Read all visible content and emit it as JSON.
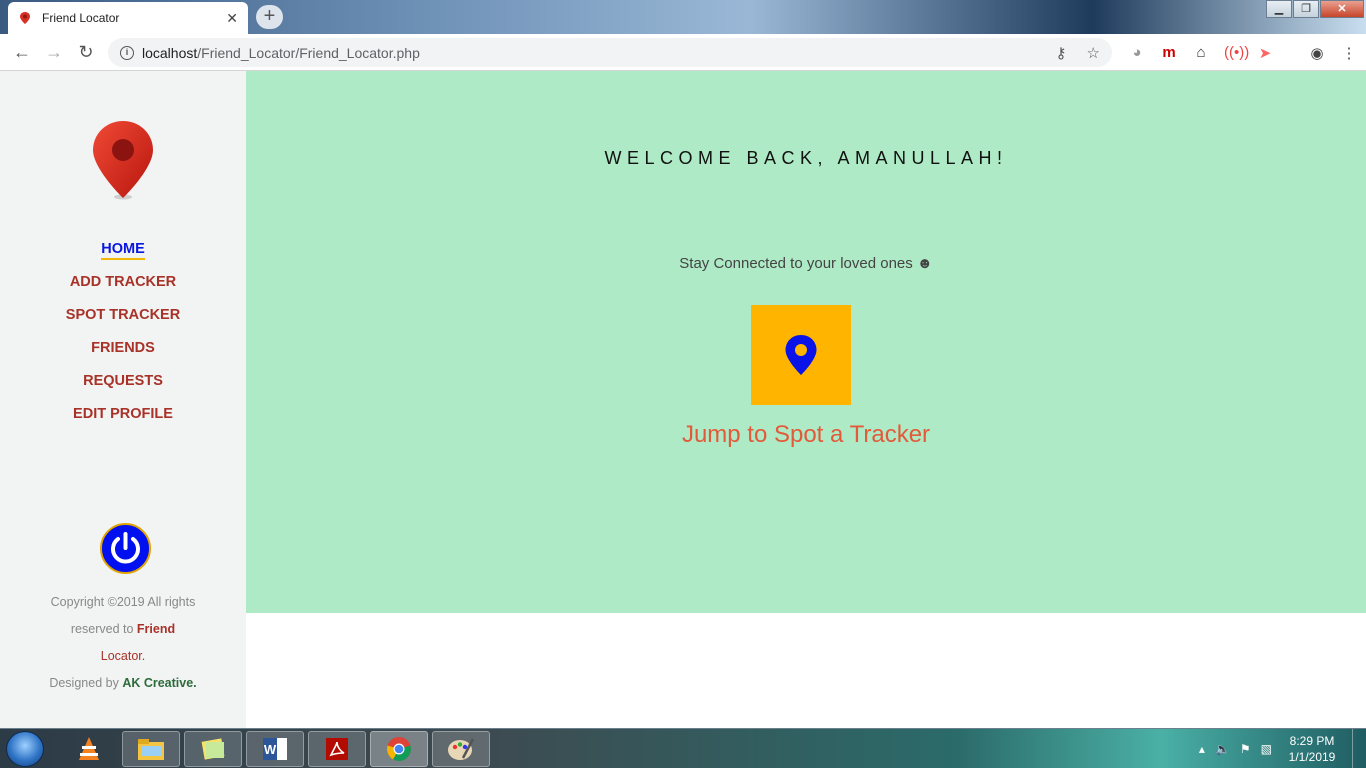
{
  "browser": {
    "tab_title": "Friend Locator",
    "tab_close": "✕",
    "new_tab": "+",
    "url_host": "localhost",
    "url_path": "/Friend_Locator/Friend_Locator.php",
    "window_buttons": [
      "▁",
      "❐",
      "✕"
    ]
  },
  "sidebar": {
    "nav": [
      {
        "label": "HOME",
        "active": true
      },
      {
        "label": "ADD TRACKER"
      },
      {
        "label": "SPOT TRACKER"
      },
      {
        "label": "FRIENDS"
      },
      {
        "label": "REQUESTS"
      },
      {
        "label": "EDIT PROFILE"
      }
    ],
    "copyright_prefix": "Copyright ©2019 All rights reserved to",
    "copyright_brand": "Friend",
    "copyright_brand2": "Locator.",
    "designed_prefix": "Designed by",
    "designer": "AK Creative."
  },
  "main": {
    "welcome": "WELCOME BACK, AMANULLAH!",
    "tagline": "Stay Connected to your loved ones ☻",
    "spot_link": "Jump to Spot a Tracker"
  },
  "taskbar": {
    "time": "8:29 PM",
    "date": "1/1/2019"
  },
  "colors": {
    "main_bg": "#aeeac6",
    "nav_color": "#a83228",
    "active_nav": "#0a16e0",
    "spot_box": "#ffb400",
    "spot_link": "#e25a3a"
  }
}
